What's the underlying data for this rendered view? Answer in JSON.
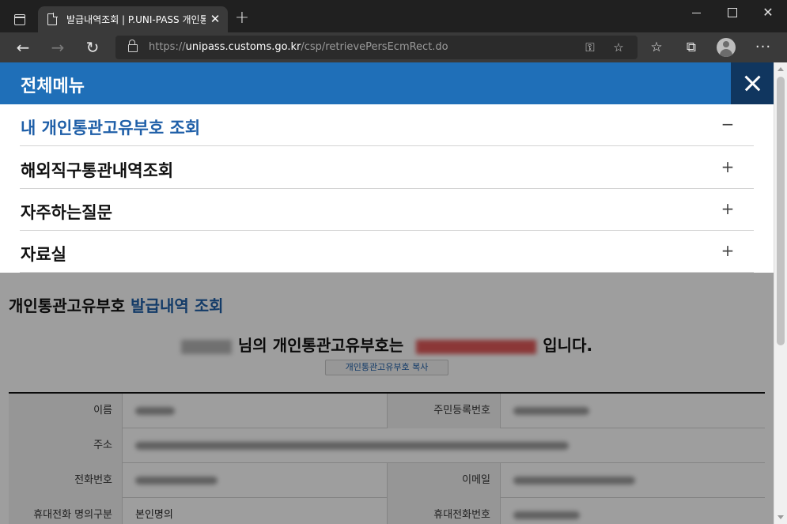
{
  "browser": {
    "tab": {
      "title": "발급내역조회 | P.UNI-PASS 개인통관고유부호",
      "close_glyph": "✕"
    },
    "new_tab_glyph": "+",
    "window_controls": {
      "close_glyph": "✕"
    },
    "nav": {
      "back_glyph": "←",
      "forward_glyph": "→",
      "reload_glyph": "↻"
    },
    "address": {
      "scheme": "https://",
      "host": "unipass.customs.go.kr",
      "path": "/csp/retrievePersEcmRect.do"
    },
    "icons": {
      "key": "⚿",
      "add_favorite": "☆",
      "favorites": "☆",
      "collections": "⧉",
      "more": "···"
    }
  },
  "menu": {
    "title": "전체메뉴",
    "items": [
      {
        "label": "내 개인통관고유부호 조회",
        "toggle": "−",
        "active": true
      },
      {
        "label": "해외직구통관내역조회",
        "toggle": "+",
        "active": false
      },
      {
        "label": "자주하는질문",
        "toggle": "+",
        "active": false
      },
      {
        "label": "자료실",
        "toggle": "+",
        "active": false
      }
    ]
  },
  "page": {
    "title_prefix": "개인통관고유부호",
    "title_accent": "발급내역 조회",
    "notice_middle": "님의 개인통관고유부호는",
    "notice_end": "입니다.",
    "copy_button": "개인통관고유부호 복사",
    "table": {
      "name_label": "이름",
      "rrn_label": "주민등록번호",
      "address_label": "주소",
      "phone_label": "전화번호",
      "email_label": "이메일",
      "mobile_type_label": "휴대전화 명의구분",
      "mobile_type_value": "본인명의",
      "mobile_label": "휴대전화번호"
    }
  },
  "colors": {
    "menu_header": "#1f6fb8",
    "menu_close_bg": "#10365f",
    "accent_text": "#1f5fa8"
  }
}
